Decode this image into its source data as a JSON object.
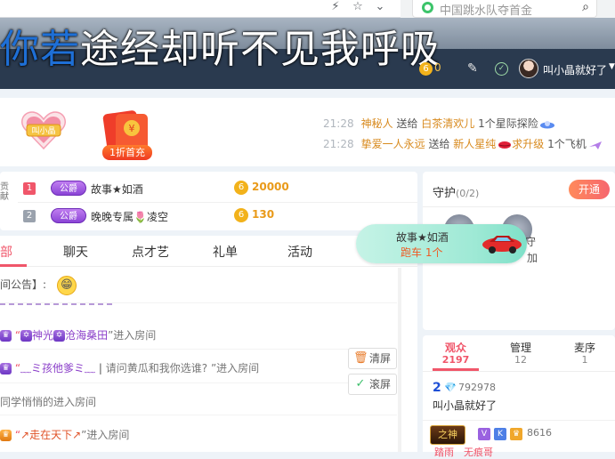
{
  "browser": {
    "bolt_icon": "bolt-icon",
    "star_icon": "star-icon",
    "caret_icon": "chevron-down-icon",
    "search_text": "中国跳水队夺首金",
    "search_icon": "search-icon"
  },
  "overlay": {
    "text_first": "你若",
    "text_rest": "途经却听不见我呼吸"
  },
  "header": {
    "coin_badge": "6",
    "coin_value": "0",
    "user_name": "叫小晶就好了",
    "caret": "▼"
  },
  "gift_banner": {
    "heart_label": "叫小晶",
    "redpack_label": "1折首充",
    "feed": [
      {
        "time": "21:28",
        "user": "神秘人",
        "verb": "送给",
        "target": "白茶清欢儿",
        "count": "1个",
        "gift": "星际探险"
      },
      {
        "time": "21:28",
        "user": "挚爱一人永远",
        "verb": "送给",
        "target": "新人星纯",
        "extra": "求升级",
        "count": "1个",
        "gift": "飞机"
      }
    ]
  },
  "rank": {
    "side_label": "贡献",
    "rows": [
      {
        "num": "1",
        "badge": "公爵",
        "name": "故事★如酒",
        "value": "20000",
        "color": "#f0566a"
      },
      {
        "num": "2",
        "badge": "公爵",
        "name": "晚晚专属🌷凌空",
        "value": "130",
        "color": "#9aa2ad"
      }
    ],
    "coin_symbol": "6"
  },
  "guard": {
    "title": "守护",
    "count": "(0/2)",
    "open_label": "开通",
    "seat_text_a": "守",
    "seat_text_b": "加"
  },
  "chat": {
    "tabs": [
      "部",
      "聊天",
      "点才艺",
      "礼单",
      "活动"
    ],
    "notice": "间公告】:",
    "lines": [
      {
        "name_a": "神光",
        "name_b": "沧海桑田",
        "suffix": "”进入房间"
      },
      {
        "name": "﹏ミ孩他爹ミ﹏",
        "quote": "请问黄瓜和我你选谁?",
        "suffix": "”进入房间"
      },
      {
        "text": "同学悄悄的进入房间"
      },
      {
        "name": "↗走在天下↗",
        "suffix": "”进入房间"
      }
    ],
    "clear_label": "清屏",
    "scroll_label": "滚屏"
  },
  "toast": {
    "sender": "故事★如酒",
    "gift": "跑车",
    "count": "1个"
  },
  "audience": {
    "tabs": [
      {
        "label": "观众",
        "count": "2197"
      },
      {
        "label": "管理",
        "count": "12"
      },
      {
        "label": "麦序",
        "count": "1"
      }
    ],
    "viewer1": {
      "level": "2",
      "id": "792978",
      "name": "叫小晶就好了"
    },
    "viewer2": {
      "badge": "之神",
      "tags": [
        "V",
        "K",
        "♛"
      ],
      "id": "8616",
      "names": "踏雨　无痕哥"
    }
  },
  "colors": {
    "accent": "#f0566a",
    "gold": "#f2b21b",
    "noble": "#8a44d6",
    "nav_dark": "#2a3a4f"
  }
}
